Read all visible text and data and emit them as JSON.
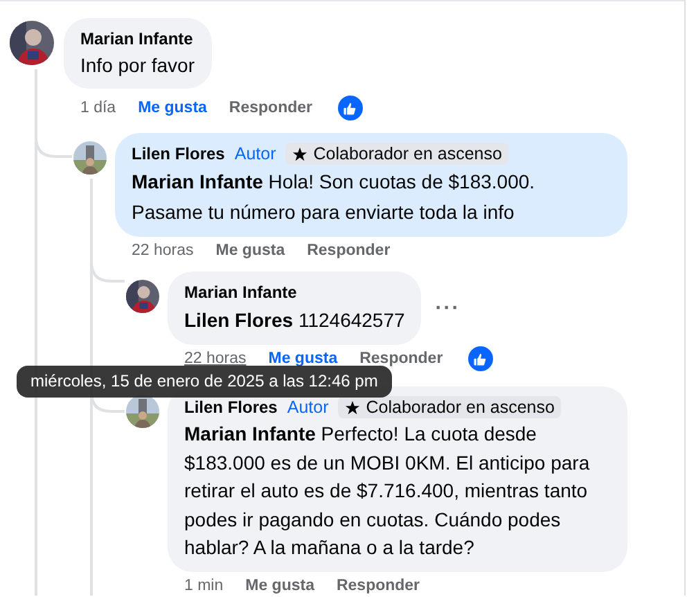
{
  "comments": [
    {
      "author": "Marian Infante",
      "text": "Info por favor",
      "highlighted": false,
      "time": "1 día",
      "time_hovered": false,
      "like": "Me gusta",
      "liked": true,
      "reply": "Responder",
      "reaction": true,
      "children": [
        {
          "author": "Lilen Flores",
          "author_badge": "Autor",
          "badge": "Colaborador en ascenso",
          "text": "**Marian Infante** Hola! Son cuotas de $183.000. Pasame tu número para enviarte toda la info",
          "highlighted": true,
          "time": "22 horas",
          "time_hovered": false,
          "like": "Me gusta",
          "liked": false,
          "reply": "Responder",
          "reaction": false,
          "children": [
            {
              "author": "Marian Infante",
              "text": "**Lilen Flores** 1124642577",
              "highlighted": false,
              "more": "···",
              "time": "22 horas",
              "time_hovered": true,
              "like": "Me gusta",
              "liked": true,
              "reply": "Responder",
              "reaction": true
            },
            {
              "author": "Lilen Flores",
              "author_badge": "Autor",
              "badge": "Colaborador en ascenso",
              "text": "**Marian Infante** Perfecto! La cuota desde $183.000 es de un MOBI 0KM. El anticipo para retirar el auto es de $7.716.400, mientras tanto podes ir pagando en cuotas. Cuándo podes hablar? A la mañana o a la tarde?",
              "highlighted": false,
              "time": "1 min",
              "time_hovered": false,
              "like": "Me gusta",
              "liked": false,
              "reply": "Responder",
              "reaction": false
            }
          ]
        }
      ]
    }
  ],
  "tooltip": "miércoles, 15 de enero de 2025 a las 12:46 pm"
}
